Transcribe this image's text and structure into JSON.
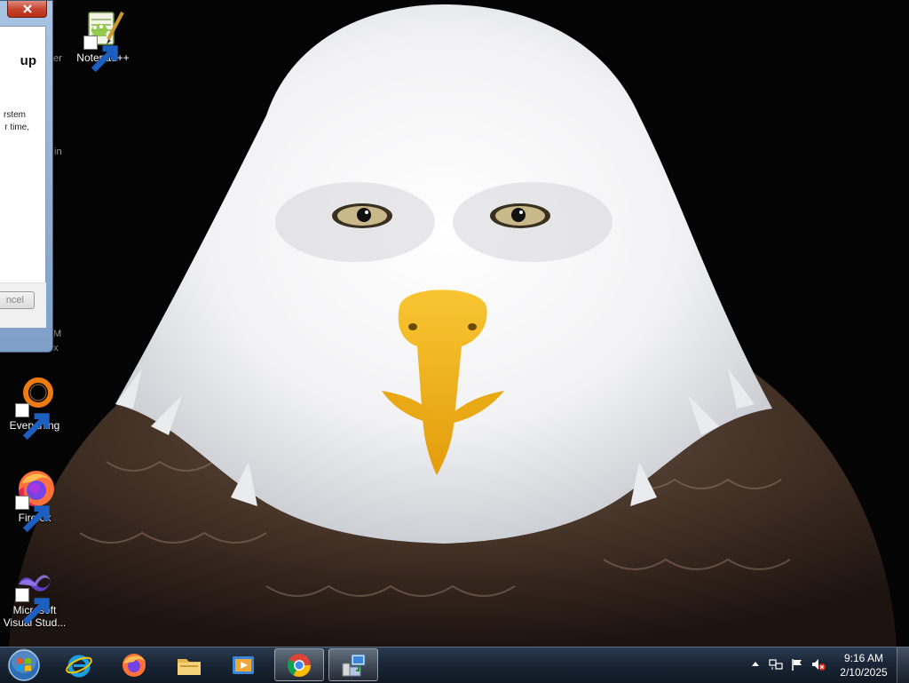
{
  "desktop": {
    "icons": [
      {
        "label": "Notepad++",
        "icon": "notepad-plus-plus-icon"
      },
      {
        "label": "Everything",
        "icon": "everything-search-icon"
      },
      {
        "label": "Firefox",
        "icon": "firefox-icon"
      },
      {
        "label": "Microsoft Visual Stud...",
        "icon": "visual-studio-icon"
      }
    ],
    "partial_labels": [
      "er",
      "in",
      "M",
      "x"
    ]
  },
  "dialog": {
    "heading_fragment": "up",
    "body_fragment_1": "rstem",
    "body_fragment_2": "r time,",
    "cancel_label": "ncel",
    "close_icon": "close-icon"
  },
  "taskbar": {
    "start_icon": "windows-start-orb-icon",
    "pinned": [
      {
        "name": "internet-explorer",
        "icon": "internet-explorer-icon"
      },
      {
        "name": "firefox",
        "icon": "firefox-icon"
      },
      {
        "name": "file-explorer",
        "icon": "folder-icon"
      },
      {
        "name": "media-player",
        "icon": "media-player-icon"
      },
      {
        "name": "chrome",
        "icon": "chrome-icon"
      },
      {
        "name": "setup-program",
        "icon": "installer-icon"
      }
    ],
    "tray": {
      "icons": [
        "show-hidden-icons-arrow",
        "network-icon",
        "action-center-flag-icon",
        "volume-muted-icon"
      ],
      "time": "9:16 AM",
      "date": "2/10/2025"
    }
  },
  "colors": {
    "taskbar": "#1a2636",
    "close_button": "#c5412b",
    "beak": "#f2b21b"
  }
}
